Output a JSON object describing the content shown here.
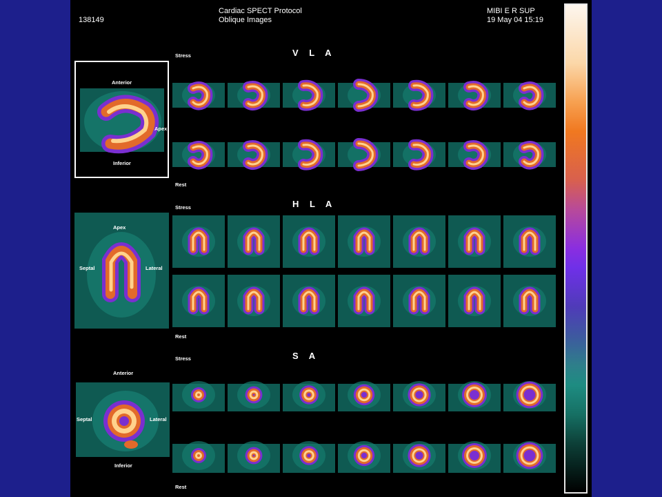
{
  "header": {
    "patient_id": "138149",
    "title": "Cardiac SPECT Protocol",
    "subtitle": "Oblique Images",
    "study": "MIBI E R SUP",
    "datetime": "19 May 04 15:19"
  },
  "sections": [
    {
      "key": "vla",
      "title": "V L A",
      "stress_label": "Stress",
      "rest_label": "Rest",
      "orientation": {
        "top": "Anterior",
        "bottom": "Inferior",
        "right": "Apex"
      }
    },
    {
      "key": "hla",
      "title": "H L A",
      "stress_label": "Stress",
      "rest_label": "Rest",
      "orientation": {
        "top": "Apex",
        "left": "Septal",
        "right": "Lateral"
      }
    },
    {
      "key": "sa",
      "title": "S A",
      "stress_label": "Stress",
      "rest_label": "Rest",
      "orientation": {
        "top": "Anterior",
        "bottom": "Inferior",
        "left": "Septal",
        "right": "Lateral"
      }
    }
  ],
  "colors": {
    "background": "#1d1f8c",
    "panel": "#000000",
    "hot": "#ffd8a0",
    "warm": "#f08020",
    "mid": "#9a2ed0",
    "cool": "#1e8c82"
  },
  "colorbar": {
    "name": "thermal-colormap-bar"
  }
}
